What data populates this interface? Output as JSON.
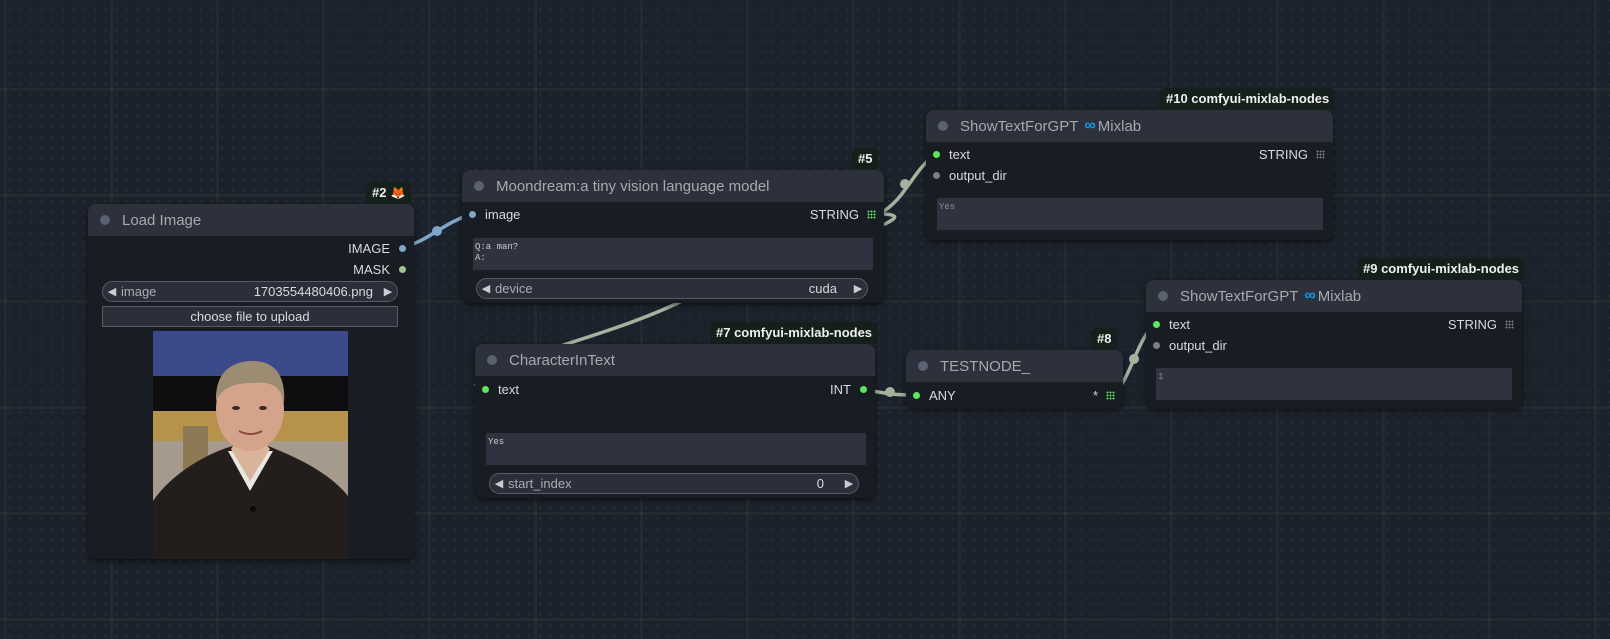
{
  "colors": {
    "image_slot": "#7ea6c9",
    "mask_slot": "#9fc58a",
    "string_slot": "#5ce85c",
    "inactive_slot": "#7a7f8a",
    "link_image": "#7ea6c9",
    "link_other": "#a6b29e",
    "badge_bg": "#13211a",
    "mixlab_accent": "#0f9aea"
  },
  "nodes": {
    "load_image": {
      "badge": "#2",
      "badge_icon": "fox-icon",
      "title": "Load Image",
      "outputs": [
        "IMAGE",
        "MASK"
      ],
      "image_widget": {
        "label": "image",
        "value": "1703554480406.png"
      },
      "upload_button": "choose file to upload",
      "preview_alt": "Photo of a man in dark polo shirt"
    },
    "moondream": {
      "badge": "#5",
      "title": "Moondream:a tiny vision language model",
      "inputs": [
        "image"
      ],
      "outputs": [
        "STRING"
      ],
      "prompt": "Q:a man?\nA:",
      "device_widget": {
        "label": "device",
        "value": "cuda"
      }
    },
    "show_text_10": {
      "badge": "#10 comfyui-mixlab-nodes",
      "title": "ShowTextForGPT",
      "brand": "Mixlab",
      "inputs": [
        "text",
        "output_dir"
      ],
      "outputs": [
        "STRING"
      ],
      "text_value": "Yes"
    },
    "character_in_text": {
      "badge": "#7 comfyui-mixlab-nodes",
      "title": "CharacterInText",
      "inputs": [
        "text"
      ],
      "outputs": [
        "INT"
      ],
      "text_value": "Yes",
      "start_index_widget": {
        "label": "start_index",
        "value": "0"
      }
    },
    "testnode": {
      "badge": "#8",
      "title": "TESTNODE_",
      "inputs": [
        "ANY"
      ],
      "outputs": [
        "*"
      ]
    },
    "show_text_9": {
      "badge": "#9 comfyui-mixlab-nodes",
      "title": "ShowTextForGPT",
      "brand": "Mixlab",
      "inputs": [
        "text",
        "output_dir"
      ],
      "outputs": [
        "STRING"
      ],
      "text_value": "1"
    }
  },
  "icons": {
    "combo_left": "◀",
    "combo_right": "▶",
    "infinity": "∞",
    "fox": "🦊"
  }
}
